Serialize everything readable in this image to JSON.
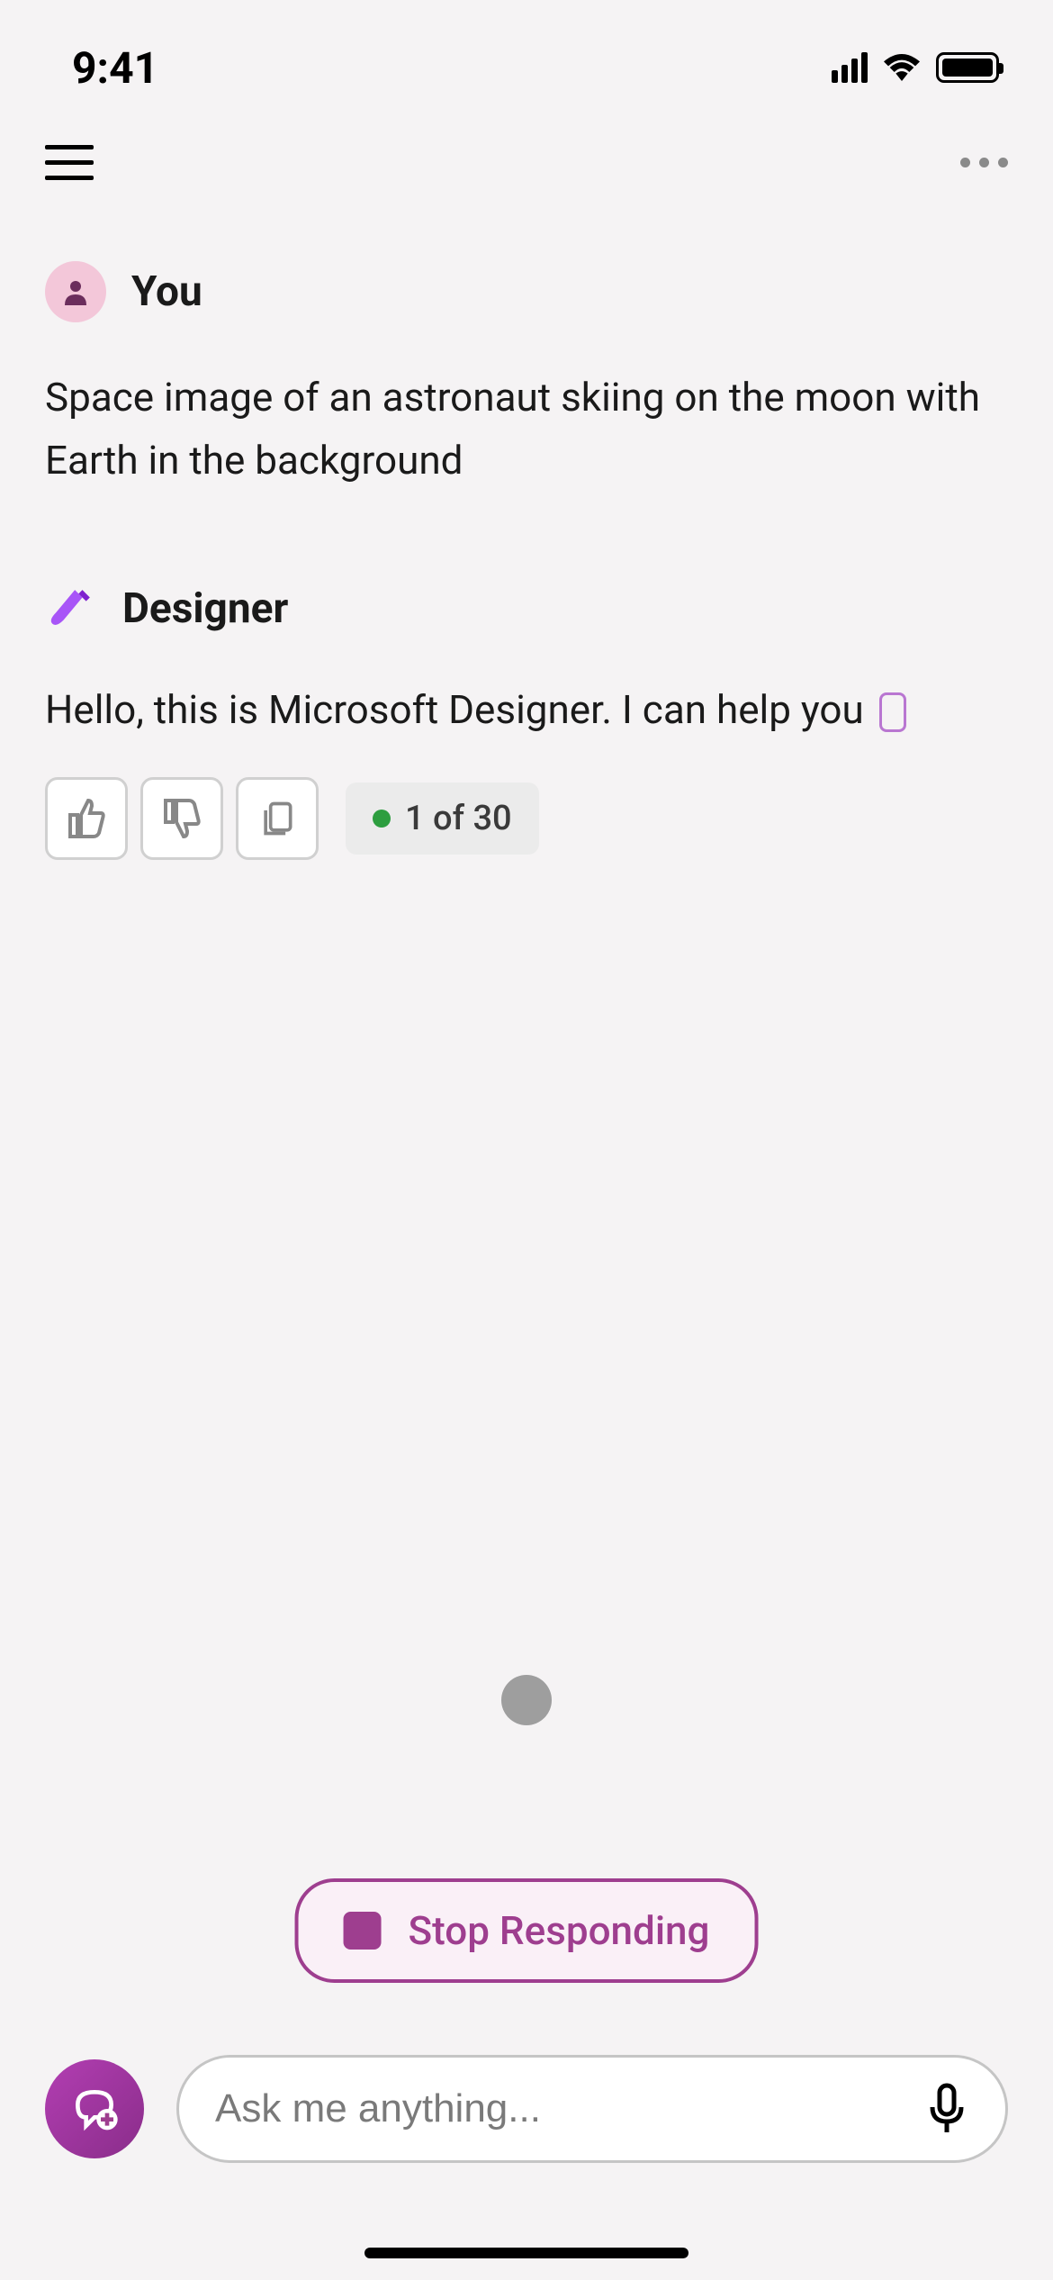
{
  "status": {
    "time": "9:41"
  },
  "messages": {
    "user": {
      "name": "You",
      "text": "Space image of an astronaut skiing on the moon with Earth in the background"
    },
    "bot": {
      "name": "Designer",
      "text": "Hello, this is Microsoft Designer. I can help you "
    }
  },
  "feedback": {
    "counter": "1 of 30"
  },
  "stop": {
    "label": "Stop Responding"
  },
  "input": {
    "placeholder": "Ask me anything..."
  }
}
